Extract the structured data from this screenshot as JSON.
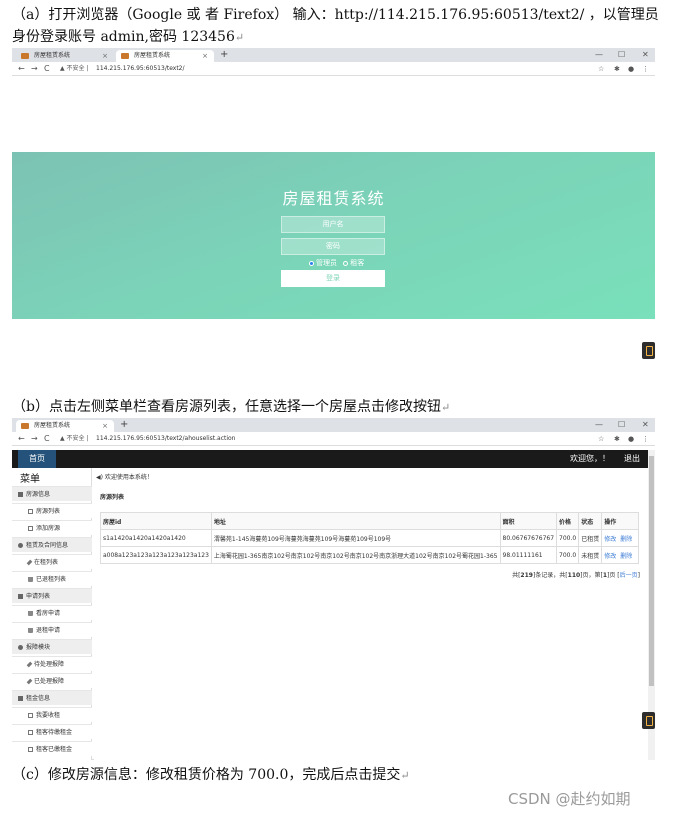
{
  "doc": {
    "step_a": "（a）打开浏览器（Google 或 者 Firefox） 输入：http://114.215.176.95:60513/text2/ ，以管理员身份登录账号 admin,密码 123456",
    "step_b": "（b）点击左侧菜单栏查看房源列表，任意选择一个房屋点击修改按钮",
    "step_c": "（c）修改房源信息：修改租赁价格为 700.0，完成后点击提交",
    "return_mark": "↵",
    "watermark": "CSDN @赴约如期"
  },
  "browser": {
    "tab_title": "房屋租赁系统",
    "new_tab": "+",
    "close_tab": "×",
    "win_min": "—",
    "win_max": "☐",
    "win_close": "✕",
    "nav_back": "←",
    "nav_forward": "→",
    "nav_reload": "C",
    "insecure_label": "▲ 不安全 |",
    "url_login": "114.215.176.95:60513/text2/",
    "url_list": "114.215.176.95:60513/text2/ahouselist.action",
    "tools_star": "☆",
    "tools_ext": "✱",
    "tools_user": "●",
    "tools_menu": "⋮"
  },
  "login": {
    "title": "房屋租赁系统",
    "username_placeholder": "用户名",
    "password_placeholder": "密码",
    "role_admin": "管理员",
    "role_tenant": "租客",
    "submit": "登录"
  },
  "admin": {
    "nav_home": "首页",
    "welcome": "欢迎您，！",
    "logout": "退出",
    "menu_title": "菜单",
    "notice": "◀) 欢迎使用本系统！",
    "section_title": "房源列表",
    "menu": [
      {
        "type": "group",
        "icon": "ico-sq",
        "label": "房源信息"
      },
      {
        "type": "item",
        "icon": "ico-doc",
        "label": "房源列表"
      },
      {
        "type": "item",
        "icon": "ico-doc",
        "label": "添加房源"
      },
      {
        "type": "group",
        "icon": "ico-gear",
        "label": "租赁及合同信息"
      },
      {
        "type": "item",
        "icon": "ico-wrench",
        "label": "在租列表"
      },
      {
        "type": "item",
        "icon": "ico-trash",
        "label": "已退租列表"
      },
      {
        "type": "group",
        "icon": "ico-sq",
        "label": "申请列表"
      },
      {
        "type": "item",
        "icon": "ico-trash",
        "label": "看房申请"
      },
      {
        "type": "item",
        "icon": "ico-trash",
        "label": "退租申请"
      },
      {
        "type": "group",
        "icon": "ico-gear",
        "label": "报障模块"
      },
      {
        "type": "item",
        "icon": "ico-wrench",
        "label": "待处理报障"
      },
      {
        "type": "item",
        "icon": "ico-wrench",
        "label": "已处理报障"
      },
      {
        "type": "group",
        "icon": "ico-sq",
        "label": "租金信息"
      },
      {
        "type": "item",
        "icon": "ico-doc",
        "label": "我要收租"
      },
      {
        "type": "item",
        "icon": "ico-doc",
        "label": "租客待缴租金"
      },
      {
        "type": "item",
        "icon": "ico-doc",
        "label": "租客已缴租金"
      }
    ],
    "table": {
      "headers": [
        "房屋id",
        "地址",
        "面积",
        "价格",
        "状态",
        "操作"
      ],
      "rows": [
        {
          "id": "s1a1420a1420a1420a1420",
          "address": "渭馨苑1-145海蔓苑109号海蔓苑海蔓苑109号海蔓苑109号109号",
          "area": "80.06767676767",
          "price": "700.0",
          "status": "已租赁",
          "edit": "修改",
          "delete": "删除"
        },
        {
          "id": "a008a123a123a123a123a123a123",
          "address": "上海蜀花园1-365南京102号南京102号南京102号南京102号南京浙理大道102号南京102号蜀花园1-365",
          "area": "98.01111161",
          "price": "700.0",
          "status": "未租赁",
          "edit": "修改",
          "delete": "删除"
        }
      ]
    },
    "pager": {
      "prefix": "共[",
      "total": "219",
      "mid1": "]条记录，共[",
      "pages": "110",
      "mid2": "]页，第[",
      "current": "1",
      "mid3": "]页 [",
      "next": "后一页",
      "suffix": "]"
    }
  }
}
